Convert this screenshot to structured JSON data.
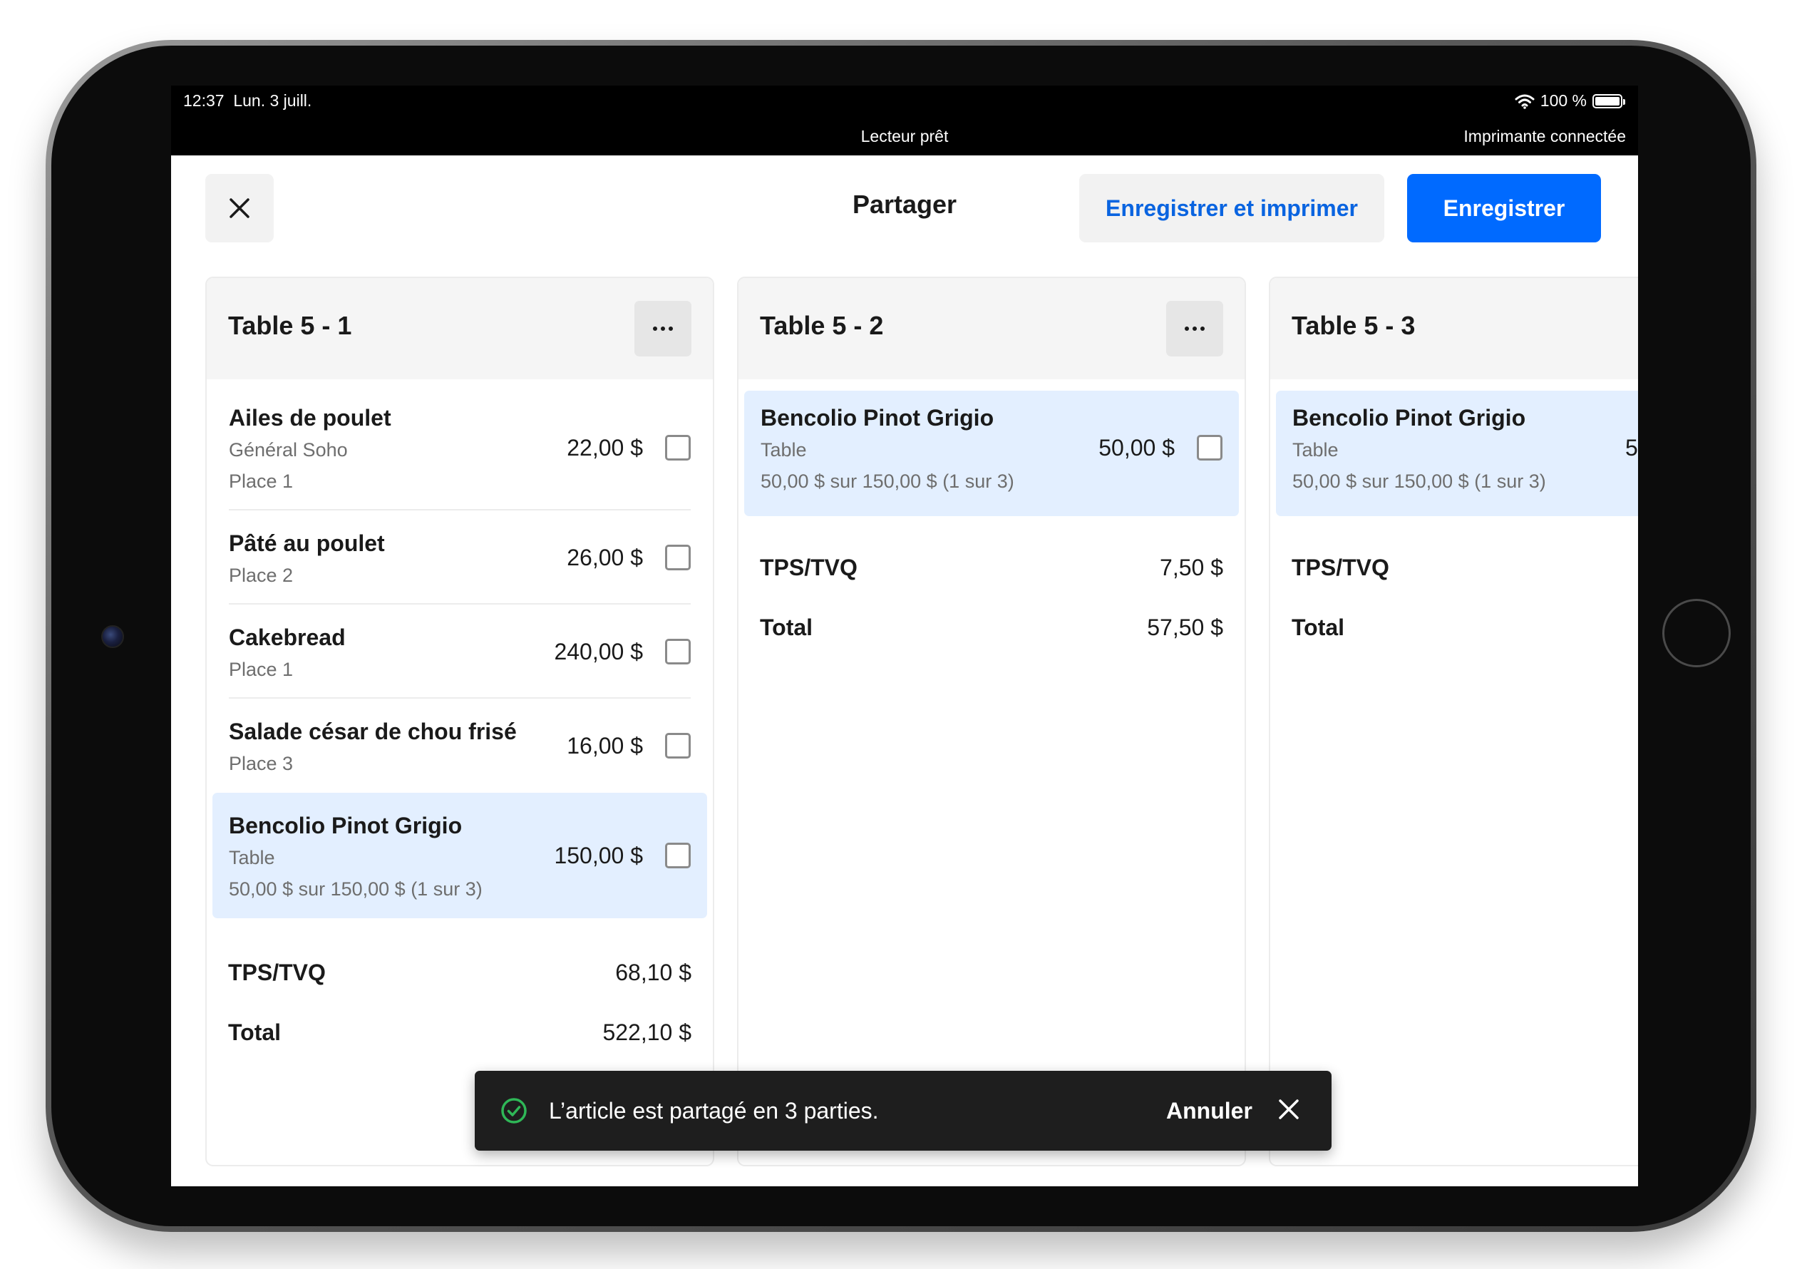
{
  "status_bar": {
    "time": "12:37",
    "date": "Lun. 3 juill.",
    "battery": "100 %",
    "reader": "Lecteur prêt",
    "printer": "Imprimante connectée"
  },
  "header": {
    "title": "Partager",
    "save_print_label": "Enregistrer et imprimer",
    "save_label": "Enregistrer"
  },
  "columns": [
    {
      "title": "Table 5 - 1",
      "items": [
        {
          "name": "Ailes de poulet",
          "details": [
            "Général Soho",
            "Place 1"
          ],
          "price": "22,00 $"
        },
        {
          "name": "Pâté au poulet",
          "details": [
            "Place 2"
          ],
          "price": "26,00 $"
        },
        {
          "name": "Cakebread",
          "details": [
            "Place 1"
          ],
          "price": "240,00 $"
        },
        {
          "name": "Salade césar de chou frisé",
          "details": [
            "Place 3"
          ],
          "price": "16,00 $"
        },
        {
          "name": "Bencolio Pinot Grigio",
          "details": [
            "Table",
            "50,00 $ sur 150,00 $ (1 sur 3)"
          ],
          "price": "150,00 $"
        }
      ],
      "tax_label": "TPS/TVQ",
      "tax": "68,10 $",
      "total_label": "Total",
      "total": "522,10 $"
    },
    {
      "title": "Table 5 - 2",
      "items": [
        {
          "name": "Bencolio Pinot Grigio",
          "details": [
            "Table",
            "50,00 $ sur 150,00 $ (1 sur 3)"
          ],
          "price": "50,00 $"
        }
      ],
      "tax_label": "TPS/TVQ",
      "tax": "7,50 $",
      "total_label": "Total",
      "total": "57,50 $"
    },
    {
      "title": "Table 5 - 3",
      "items": [
        {
          "name": "Bencolio Pinot Grigio",
          "details": [
            "Table",
            "50,00 $ sur 150,00 $ (1 sur 3)"
          ],
          "price": "5"
        }
      ],
      "tax_label": "TPS/TVQ",
      "total_label": "Total"
    }
  ],
  "toast": {
    "message": "L’article est partagé en 3 parties.",
    "undo_label": "Annuler"
  },
  "colors": {
    "accent": "#006aff",
    "link": "#0a64e0",
    "highlight": "#e3efff",
    "success": "#2fb757",
    "toast_bg": "#1e1e1e"
  },
  "icons": {
    "close": "close-icon",
    "more": "more-horizontal-icon",
    "wifi": "wifi-icon",
    "battery": "battery-icon",
    "success": "check-circle-icon"
  }
}
